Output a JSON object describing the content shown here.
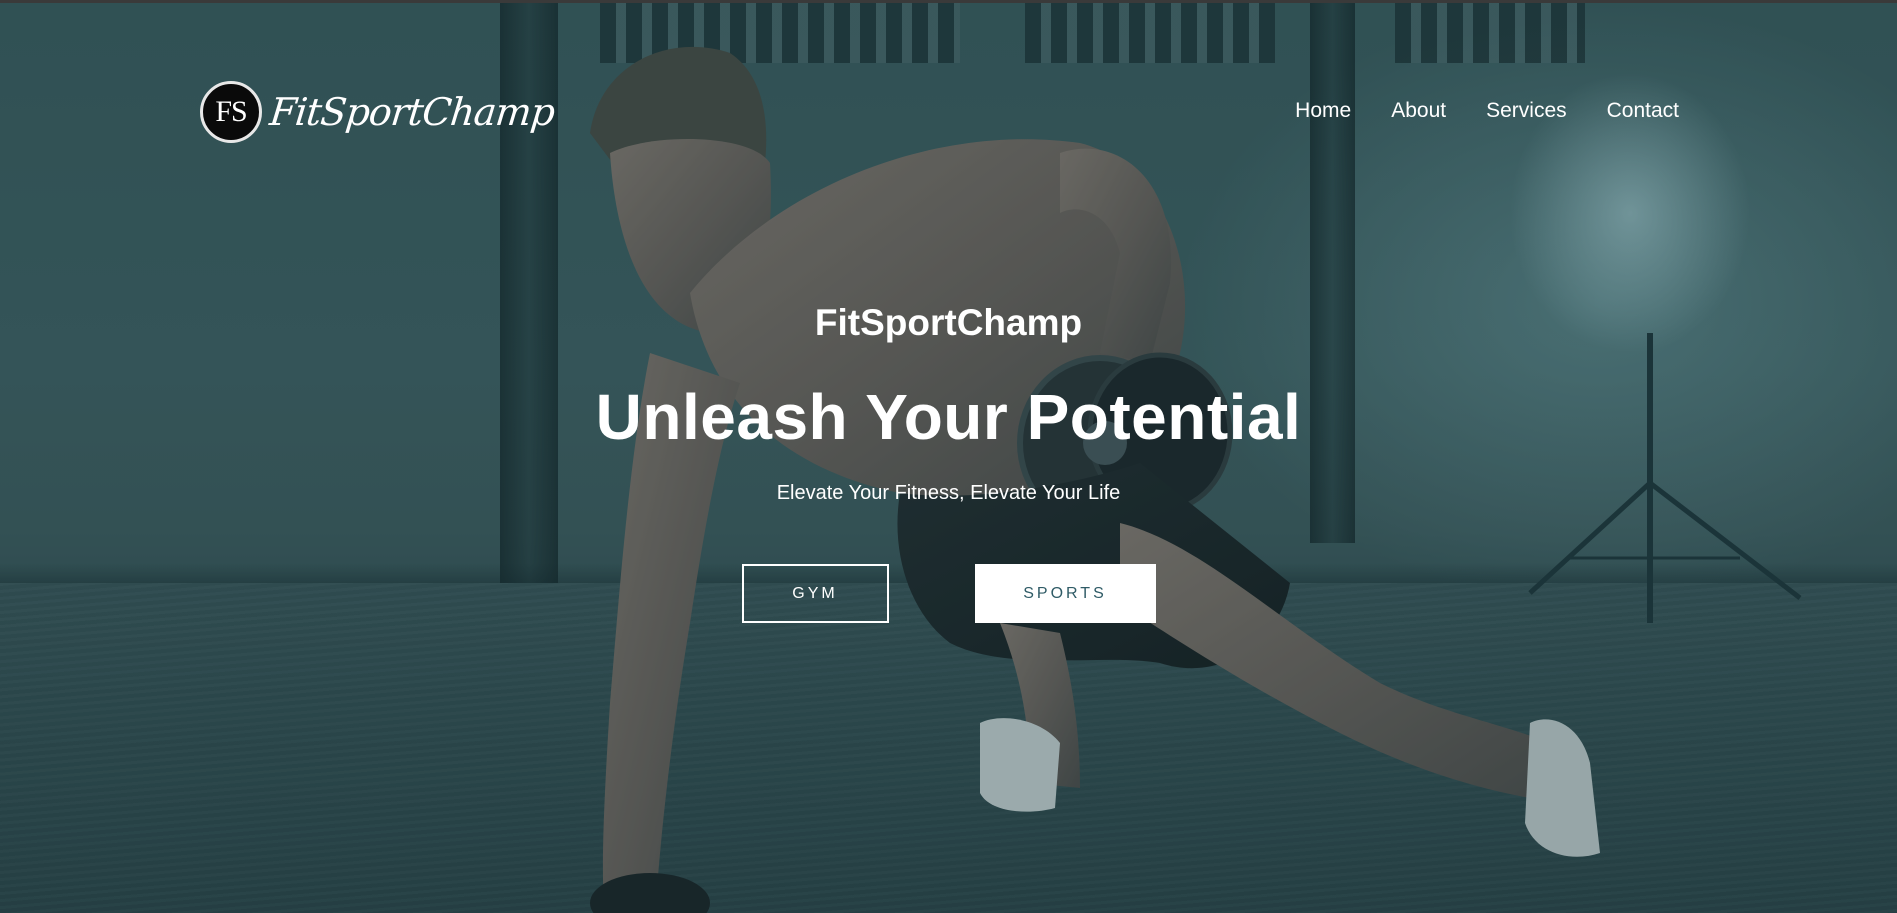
{
  "header": {
    "logo_badge": "FS",
    "logo_text": "FitSportChamp",
    "nav": [
      {
        "label": "Home"
      },
      {
        "label": "About"
      },
      {
        "label": "Services"
      },
      {
        "label": "Contact"
      }
    ]
  },
  "hero": {
    "brand_title": "FitSportChamp",
    "headline": "Unleash Your Potential",
    "tagline": "Elevate Your Fitness, Elevate Your Life",
    "buttons": [
      {
        "label": "GYM"
      },
      {
        "label": "SPORTS"
      }
    ]
  },
  "colors": {
    "overlay": "#163a40",
    "button_text": "#2f5b66",
    "text": "#ffffff"
  }
}
